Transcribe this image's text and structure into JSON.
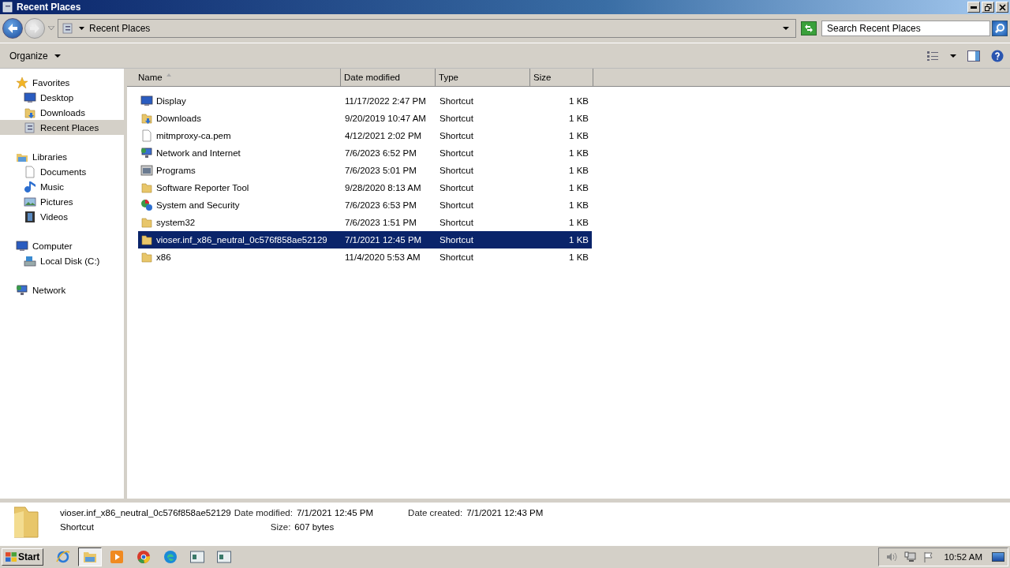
{
  "window": {
    "title": "Recent Places"
  },
  "address_bar": {
    "path": "Recent Places",
    "search": {
      "placeholder": "Search Recent Places"
    }
  },
  "command_bar": {
    "organize": "Organize"
  },
  "sidebar": {
    "groups": [
      {
        "label": "Favorites",
        "kind": "star",
        "selected": false,
        "children": [
          {
            "label": "Desktop",
            "kind": "desktop",
            "selected": false
          },
          {
            "label": "Downloads",
            "kind": "downloads",
            "selected": false
          },
          {
            "label": "Recent Places",
            "kind": "recent",
            "selected": true
          }
        ]
      },
      {
        "label": "Libraries",
        "kind": "library",
        "selected": false,
        "children": [
          {
            "label": "Documents",
            "kind": "file",
            "selected": false
          },
          {
            "label": "Music",
            "kind": "music",
            "selected": false
          },
          {
            "label": "Pictures",
            "kind": "pictures",
            "selected": false
          },
          {
            "label": "Videos",
            "kind": "videos",
            "selected": false
          }
        ]
      },
      {
        "label": "Computer",
        "kind": "desktop",
        "selected": false,
        "children": [
          {
            "label": "Local Disk (C:)",
            "kind": "disk",
            "selected": false
          }
        ]
      },
      {
        "label": "Network",
        "kind": "network",
        "selected": false
      }
    ]
  },
  "table": {
    "columns": [
      "Name",
      "Date modified",
      "Type",
      "Size"
    ],
    "rows": [
      {
        "kind": "desktop",
        "name": "Display",
        "date": "11/17/2022 2:47 PM",
        "type": "Shortcut",
        "size": "1 KB",
        "selected": false
      },
      {
        "kind": "downloads",
        "name": "Downloads",
        "date": "9/20/2019 10:47 AM",
        "type": "Shortcut",
        "size": "1 KB",
        "selected": false
      },
      {
        "kind": "file",
        "name": "mitmproxy-ca.pem",
        "date": "4/12/2021 2:02 PM",
        "type": "Shortcut",
        "size": "1 KB",
        "selected": false
      },
      {
        "kind": "network",
        "name": "Network and Internet",
        "date": "7/6/2023 6:52 PM",
        "type": "Shortcut",
        "size": "1 KB",
        "selected": false
      },
      {
        "kind": "programs",
        "name": "Programs",
        "date": "7/6/2023 5:01 PM",
        "type": "Shortcut",
        "size": "1 KB",
        "selected": false
      },
      {
        "kind": "folder",
        "name": "Software Reporter Tool",
        "date": "9/28/2020 8:13 AM",
        "type": "Shortcut",
        "size": "1 KB",
        "selected": false
      },
      {
        "kind": "security",
        "name": "System and Security",
        "date": "7/6/2023 6:53 PM",
        "type": "Shortcut",
        "size": "1 KB",
        "selected": false
      },
      {
        "kind": "folder",
        "name": "system32",
        "date": "7/6/2023 1:51 PM",
        "type": "Shortcut",
        "size": "1 KB",
        "selected": false
      },
      {
        "kind": "folder",
        "name": "vioser.inf_x86_neutral_0c576f858ae52129",
        "date": "7/1/2021 12:45 PM",
        "type": "Shortcut",
        "size": "1 KB",
        "selected": true
      },
      {
        "kind": "folder",
        "name": "x86",
        "date": "11/4/2020 5:53 AM",
        "type": "Shortcut",
        "size": "1 KB",
        "selected": false
      }
    ]
  },
  "details_pane": {
    "name": "vioser.inf_x86_neutral_0c576f858ae52129",
    "type": "Shortcut",
    "modified_label": "Date modified:",
    "modified": "7/1/2021 12:45 PM",
    "size_label": "Size:",
    "size": "607 bytes",
    "created_label": "Date created:",
    "created": "7/1/2021 12:43 PM"
  },
  "taskbar": {
    "start": "Start",
    "buttons": [
      {
        "kind": "ie",
        "selected": false
      },
      {
        "kind": "explorer",
        "selected": true
      },
      {
        "kind": "media",
        "selected": false
      },
      {
        "kind": "chrome",
        "selected": false
      },
      {
        "kind": "edge",
        "selected": false
      },
      {
        "kind": "window",
        "selected": false
      },
      {
        "kind": "window",
        "selected": false
      }
    ],
    "clock": "10:52 AM"
  }
}
